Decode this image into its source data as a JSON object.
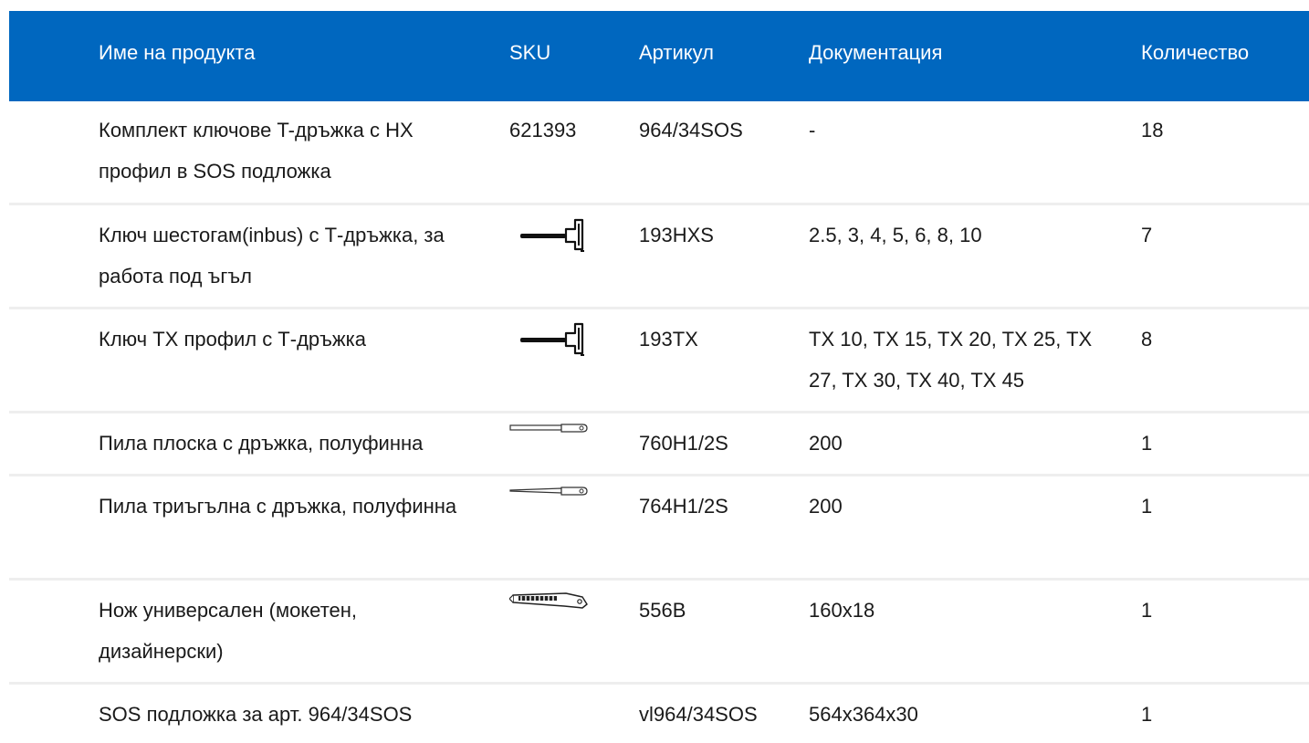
{
  "table": {
    "headers": {
      "name": "Име на продукта",
      "sku": "SKU",
      "article": "Артикул",
      "documentation": "Документация",
      "quantity": "Количество"
    },
    "rows": [
      {
        "name": "Комплект ключове T-дръжка с HX профил в SOS подложка",
        "sku": "621393",
        "article": "964/34SOS",
        "documentation": "-",
        "quantity": "18"
      },
      {
        "name": "Ключ шестогам(inbus) с Т-дръжка, за работа под ъгъл",
        "sku_icon": "t-handle-key-icon",
        "article": "193HXS",
        "documentation": "2.5, 3, 4, 5, 6, 8, 10",
        "quantity": "7"
      },
      {
        "name": "Ключ TX профил с Т-дръжка",
        "sku_icon": "t-handle-key-icon",
        "article": "193TX",
        "documentation": "TX 10, TX 15, TX 20, TX 25, TX 27, TX 30, TX 40, TX 45",
        "quantity": "8"
      },
      {
        "name": "Пила плоска с дръжка, полуфинна",
        "sku_icon": "flat-file-icon",
        "article": "760H1/2S",
        "documentation": "200",
        "quantity": "1"
      },
      {
        "name": "Пила триъгълна с дръжка, полуфинна",
        "sku_icon": "triangular-file-icon",
        "article": "764H1/2S",
        "documentation": "200",
        "quantity": "1"
      },
      {
        "name": "Нож универсален (мокетен, дизайнерски)",
        "sku_icon": "utility-knife-icon",
        "article": "556B",
        "documentation": "160x18",
        "quantity": "1"
      },
      {
        "name": "SOS подложка за арт. 964/34SOS",
        "article": "vl964/34SOS",
        "documentation": "564x364x30",
        "quantity": "1"
      }
    ]
  }
}
